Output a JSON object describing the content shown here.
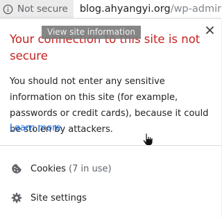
{
  "omnibox": {
    "security_chip_label": "Not secure",
    "security_icon": "info-circle-icon",
    "url_host": "blog.ahyangyi.org",
    "url_path": "/wp-admin/p"
  },
  "popup": {
    "tooltip": "View site information",
    "title": "Your connection to this site is not secure",
    "body": "You should not enter any sensitive information on this site (for example, passwords or credit cards), because it could be stolen by attackers.",
    "learn_more": "Learn more",
    "close_icon": "close-icon",
    "cookies": {
      "label": "Cookies",
      "count": "(7 in use)",
      "icon": "cookie-icon"
    },
    "site_settings": {
      "label": "Site settings",
      "icon": "gear-icon"
    }
  },
  "colors": {
    "title_red": "#c5221f",
    "link_blue": "#1a73e8",
    "chip_bg": "#ebebeb",
    "muted_text": "#5f6368"
  }
}
